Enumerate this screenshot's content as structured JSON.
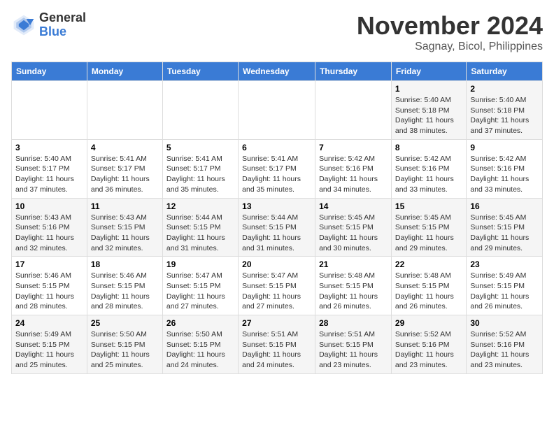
{
  "logo": {
    "general": "General",
    "blue": "Blue"
  },
  "title": "November 2024",
  "location": "Sagnay, Bicol, Philippines",
  "weekdays": [
    "Sunday",
    "Monday",
    "Tuesday",
    "Wednesday",
    "Thursday",
    "Friday",
    "Saturday"
  ],
  "weeks": [
    [
      {
        "day": "",
        "info": ""
      },
      {
        "day": "",
        "info": ""
      },
      {
        "day": "",
        "info": ""
      },
      {
        "day": "",
        "info": ""
      },
      {
        "day": "",
        "info": ""
      },
      {
        "day": "1",
        "info": "Sunrise: 5:40 AM\nSunset: 5:18 PM\nDaylight: 11 hours and 38 minutes."
      },
      {
        "day": "2",
        "info": "Sunrise: 5:40 AM\nSunset: 5:18 PM\nDaylight: 11 hours and 37 minutes."
      }
    ],
    [
      {
        "day": "3",
        "info": "Sunrise: 5:40 AM\nSunset: 5:17 PM\nDaylight: 11 hours and 37 minutes."
      },
      {
        "day": "4",
        "info": "Sunrise: 5:41 AM\nSunset: 5:17 PM\nDaylight: 11 hours and 36 minutes."
      },
      {
        "day": "5",
        "info": "Sunrise: 5:41 AM\nSunset: 5:17 PM\nDaylight: 11 hours and 35 minutes."
      },
      {
        "day": "6",
        "info": "Sunrise: 5:41 AM\nSunset: 5:17 PM\nDaylight: 11 hours and 35 minutes."
      },
      {
        "day": "7",
        "info": "Sunrise: 5:42 AM\nSunset: 5:16 PM\nDaylight: 11 hours and 34 minutes."
      },
      {
        "day": "8",
        "info": "Sunrise: 5:42 AM\nSunset: 5:16 PM\nDaylight: 11 hours and 33 minutes."
      },
      {
        "day": "9",
        "info": "Sunrise: 5:42 AM\nSunset: 5:16 PM\nDaylight: 11 hours and 33 minutes."
      }
    ],
    [
      {
        "day": "10",
        "info": "Sunrise: 5:43 AM\nSunset: 5:16 PM\nDaylight: 11 hours and 32 minutes."
      },
      {
        "day": "11",
        "info": "Sunrise: 5:43 AM\nSunset: 5:15 PM\nDaylight: 11 hours and 32 minutes."
      },
      {
        "day": "12",
        "info": "Sunrise: 5:44 AM\nSunset: 5:15 PM\nDaylight: 11 hours and 31 minutes."
      },
      {
        "day": "13",
        "info": "Sunrise: 5:44 AM\nSunset: 5:15 PM\nDaylight: 11 hours and 31 minutes."
      },
      {
        "day": "14",
        "info": "Sunrise: 5:45 AM\nSunset: 5:15 PM\nDaylight: 11 hours and 30 minutes."
      },
      {
        "day": "15",
        "info": "Sunrise: 5:45 AM\nSunset: 5:15 PM\nDaylight: 11 hours and 29 minutes."
      },
      {
        "day": "16",
        "info": "Sunrise: 5:45 AM\nSunset: 5:15 PM\nDaylight: 11 hours and 29 minutes."
      }
    ],
    [
      {
        "day": "17",
        "info": "Sunrise: 5:46 AM\nSunset: 5:15 PM\nDaylight: 11 hours and 28 minutes."
      },
      {
        "day": "18",
        "info": "Sunrise: 5:46 AM\nSunset: 5:15 PM\nDaylight: 11 hours and 28 minutes."
      },
      {
        "day": "19",
        "info": "Sunrise: 5:47 AM\nSunset: 5:15 PM\nDaylight: 11 hours and 27 minutes."
      },
      {
        "day": "20",
        "info": "Sunrise: 5:47 AM\nSunset: 5:15 PM\nDaylight: 11 hours and 27 minutes."
      },
      {
        "day": "21",
        "info": "Sunrise: 5:48 AM\nSunset: 5:15 PM\nDaylight: 11 hours and 26 minutes."
      },
      {
        "day": "22",
        "info": "Sunrise: 5:48 AM\nSunset: 5:15 PM\nDaylight: 11 hours and 26 minutes."
      },
      {
        "day": "23",
        "info": "Sunrise: 5:49 AM\nSunset: 5:15 PM\nDaylight: 11 hours and 26 minutes."
      }
    ],
    [
      {
        "day": "24",
        "info": "Sunrise: 5:49 AM\nSunset: 5:15 PM\nDaylight: 11 hours and 25 minutes."
      },
      {
        "day": "25",
        "info": "Sunrise: 5:50 AM\nSunset: 5:15 PM\nDaylight: 11 hours and 25 minutes."
      },
      {
        "day": "26",
        "info": "Sunrise: 5:50 AM\nSunset: 5:15 PM\nDaylight: 11 hours and 24 minutes."
      },
      {
        "day": "27",
        "info": "Sunrise: 5:51 AM\nSunset: 5:15 PM\nDaylight: 11 hours and 24 minutes."
      },
      {
        "day": "28",
        "info": "Sunrise: 5:51 AM\nSunset: 5:15 PM\nDaylight: 11 hours and 23 minutes."
      },
      {
        "day": "29",
        "info": "Sunrise: 5:52 AM\nSunset: 5:16 PM\nDaylight: 11 hours and 23 minutes."
      },
      {
        "day": "30",
        "info": "Sunrise: 5:52 AM\nSunset: 5:16 PM\nDaylight: 11 hours and 23 minutes."
      }
    ]
  ]
}
